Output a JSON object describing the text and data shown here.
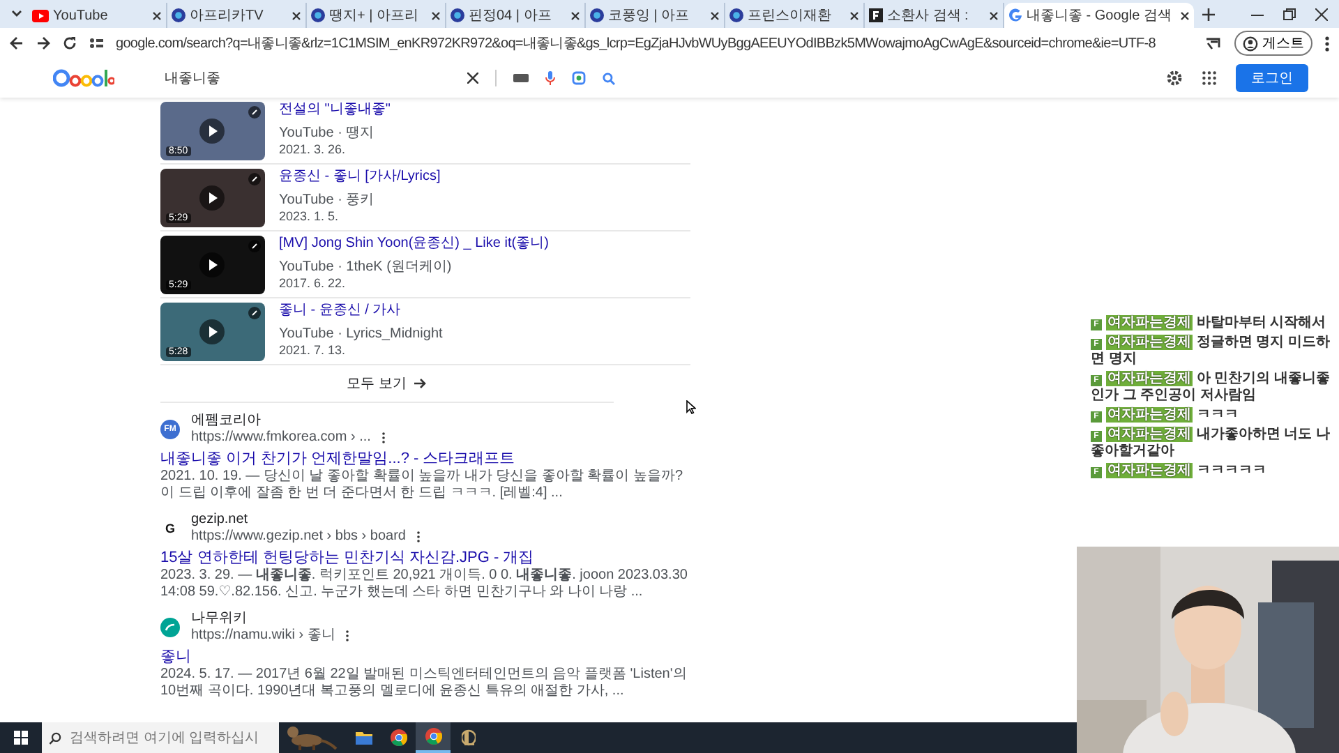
{
  "tabs": [
    {
      "title": "YouTube",
      "kind": "youtube",
      "selected": false
    },
    {
      "title": "아프리카TV",
      "kind": "afreeca",
      "selected": false
    },
    {
      "title": "땡지+ | 아프리",
      "kind": "afreeca",
      "selected": false
    },
    {
      "title": "핀정04 | 아프",
      "kind": "afreeca",
      "selected": false
    },
    {
      "title": "코풍잉 | 아프",
      "kind": "afreeca",
      "selected": false
    },
    {
      "title": "프린스이재환",
      "kind": "afreeca",
      "selected": false
    },
    {
      "title": "소환사 검색 :",
      "kind": "letter",
      "selected": false
    },
    {
      "title": "내좋니좋 - Google 검색",
      "kind": "google",
      "selected": true
    }
  ],
  "address": "google.com/search?q=내좋니좋&rlz=1C1MSIM_enKR972KR972&oq=내좋니좋&gs_lcrp=EgZjaHJvbWUyBggAEEUYOdIBBzk5MWowajmoAgCwAgE&sourceid=chrome&ie=UTF-8",
  "guest_label": "게스트",
  "search": {
    "value": "내좋니좋"
  },
  "login_button": "로그인",
  "videos": [
    {
      "title": "전설의 \"니좋내좋\"",
      "source": "YouTube · 땡지",
      "date": "2021. 3. 26.",
      "duration": "8:50",
      "color": "#5a6a8a"
    },
    {
      "title": "윤종신 - 좋니 [가사/Lyrics]",
      "source": "YouTube · 풍키",
      "date": "2023. 1. 5.",
      "duration": "5:29",
      "color": "#3a3030"
    },
    {
      "title": "[MV] Jong Shin Yoon(윤종신) _ Like it(좋니)",
      "source": "YouTube · 1theK (원더케이)",
      "date": "2017. 6. 22.",
      "duration": "5:29",
      "color": "#111111"
    },
    {
      "title": "좋니 - 윤종신 / 가사",
      "source": "YouTube · Lyrics_Midnight",
      "date": "2021. 7. 13.",
      "duration": "5:28",
      "color": "#3c6a78"
    }
  ],
  "show_all": "모두 보기",
  "results": [
    {
      "site": "에펨코리아",
      "url": "https://www.fmkorea.com › ...",
      "logo": "FM",
      "kind": "fm",
      "title": "내좋니좋 이거 찬기가 언제한말임...? - 스타크래프트",
      "snippet": "2021. 10. 19. — 당신이 날 좋아할 확률이 높을까 내가 당신을 좋아할 확률이 높을까? 이 드립 이후에 잘좀 한 번 더 준다면서 한 드립 ㅋㅋㅋ. [레벨:4] ..."
    },
    {
      "site": "gezip.net",
      "url": "https://www.gezip.net › bbs › board",
      "logo": "G",
      "kind": "gezip",
      "title": "15살 연하한테 헌팅당하는 민찬기식 자신감.JPG - 개집",
      "snippet": "2023. 3. 29. — **내좋니좋**. 럭키포인트 20,921 개이득. 0 0. **내좋니좋**. jooon 2023.03.30 14:08 59.♡.82.156. 신고. 누군가 했는데 스타 하면 민찬기구나 와 나이 나랑 ..."
    },
    {
      "site": "나무위키",
      "url": "https://namu.wiki › 좋니",
      "kind": "namu",
      "title": "좋니",
      "snippet": "2024. 5. 17. — 2017년 6월 22일 발매된 미스틱엔터테인먼트의 음악 플랫폼 'Listen'의 10번째 곡이다. 1990년대 복고풍의 멜로디에 윤종신 특유의 애절한 가사, ..."
    }
  ],
  "chat": [
    {
      "badge": "F",
      "user": "여자파는경제",
      "text": "바탈마부터 시작해서"
    },
    {
      "badge": "F",
      "user": "여자파는경제",
      "text": "정글하면 명지 미드하면 명지"
    },
    {
      "badge": "F",
      "user": "여자파는경제",
      "text": "아 민찬기의 내좋니좋인가 그 주인공이 저사람임"
    },
    {
      "badge": "F",
      "user": "여자파는경제",
      "text": "ㅋㅋㅋ"
    },
    {
      "badge": "F",
      "user": "여자파는경제",
      "text": "내가좋아하면 너도 나좋아할거같아"
    },
    {
      "badge": "F",
      "user": "여자파는경제",
      "text": "ㅋㅋㅋㅋㅋ"
    }
  ],
  "taskbar": {
    "search_placeholder": "검색하려면 여기에 입력하십시",
    "apps": [
      {
        "kind": "folder",
        "selected": false
      },
      {
        "kind": "chrome",
        "selected": false
      },
      {
        "kind": "chrome",
        "selected": true
      },
      {
        "kind": "game",
        "selected": false
      }
    ]
  }
}
